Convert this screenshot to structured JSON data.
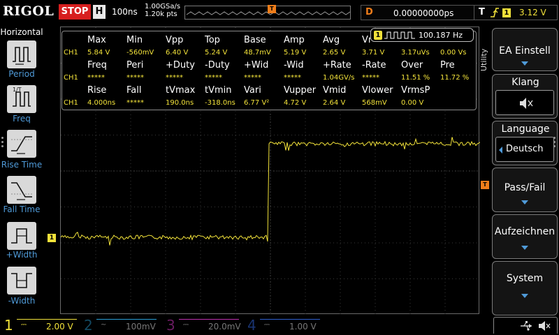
{
  "top": {
    "logo": "RIGOL",
    "run_state": "STOP",
    "h_label": "H",
    "timebase": "100ns",
    "sample_rate": "1.00GSa/s",
    "mem_depth": "1.20k pts",
    "trigger_pos_marker": "T",
    "delay_label": "D",
    "delay_value": "0.00000000ps",
    "trigger_label": "T",
    "trigger_edge_icon": "rising-edge-icon",
    "trigger_source": "1",
    "trigger_level": "3.12 V"
  },
  "left_menu": {
    "title": "Horizontal",
    "items": [
      {
        "label": "Period",
        "icon": "period-icon"
      },
      {
        "label": "Freq",
        "icon": "frequency-icon"
      },
      {
        "label": "Rise Time",
        "icon": "rise-time-icon"
      },
      {
        "label": "Fall Time",
        "icon": "fall-time-icon"
      },
      {
        "label": "+Width",
        "icon": "positive-width-icon"
      },
      {
        "label": "-Width",
        "icon": "negative-width-icon"
      }
    ]
  },
  "measurements": {
    "row1_headers": [
      "Max",
      "Min",
      "Vpp",
      "Top",
      "Base",
      "Amp",
      "Avg",
      "Vr"
    ],
    "row1_values": [
      "CH1",
      "5.84 V",
      "-560mV",
      "6.40 V",
      "5.24 V",
      "48.7mV",
      "5.19 V",
      "2.65 V",
      "3.71 V",
      "3.17uVs",
      "0.00 Vs"
    ],
    "row2_headers": [
      "Freq",
      "Peri",
      "+Duty",
      "-Duty",
      "+Wid",
      "-Wid",
      "+Rate",
      "-Rate",
      "Over",
      "Pre"
    ],
    "row2_values": [
      "CH1",
      "*****",
      "*****",
      "*****",
      "*****",
      "*****",
      "*****",
      "1.04GV/s",
      "*****",
      "11.51 %",
      "11.72 %"
    ],
    "row3_headers": [
      "Rise",
      "Fall",
      "tVmax",
      "tVmin",
      "Vari",
      "Vupper",
      "Vmid",
      "Vlower",
      "VrmsP"
    ],
    "row3_values": [
      "CH1",
      "4.000ns",
      "*****",
      "190.0ns",
      "-318.0ns",
      "6.77 V²",
      "4.72 V",
      "2.64 V",
      "568mV",
      "0.00 V"
    ]
  },
  "freq_counter": {
    "source": "1",
    "value": "100.187 Hz"
  },
  "right_menu": {
    "tab": "Utility",
    "items": [
      {
        "label": "EA Einstell"
      },
      {
        "label": "Klang",
        "value_icon": "speaker-muted-icon"
      },
      {
        "label": "Language",
        "value": "Deutsch"
      },
      {
        "label": "Pass/Fail"
      },
      {
        "label": "Aufzeichnen"
      },
      {
        "label": "System"
      }
    ]
  },
  "channels": [
    {
      "num": "1",
      "coupling_icon": "dc-coupling-icon",
      "scale": "2.00 V",
      "active": true,
      "color": "#f2e23a"
    },
    {
      "num": "2",
      "coupling_icon": "ac-coupling-icon",
      "scale": "100mV",
      "active": false,
      "color": "#2a9fd6"
    },
    {
      "num": "3",
      "coupling_icon": "dc-coupling-icon",
      "scale": "20.0mV",
      "active": false,
      "color": "#c032b0"
    },
    {
      "num": "4",
      "coupling_icon": "dc-coupling-icon",
      "scale": "1.00 V",
      "active": false,
      "color": "#2f5fd0"
    }
  ],
  "markers": {
    "ch1_ground": "1",
    "trigger_level": "T"
  },
  "waveform": {
    "channel": "1",
    "low_level_v": 0.0,
    "high_level_v": 5.2,
    "edge_time_ns": 0,
    "display_window_ns": [
      -600,
      600
    ],
    "color": "#f2e23a"
  },
  "colors": {
    "ch1": "#f2e23a",
    "accent_orange": "#ef7d1a",
    "accent_blue": "#4f9ad8",
    "stop_red": "#d71f1f"
  }
}
